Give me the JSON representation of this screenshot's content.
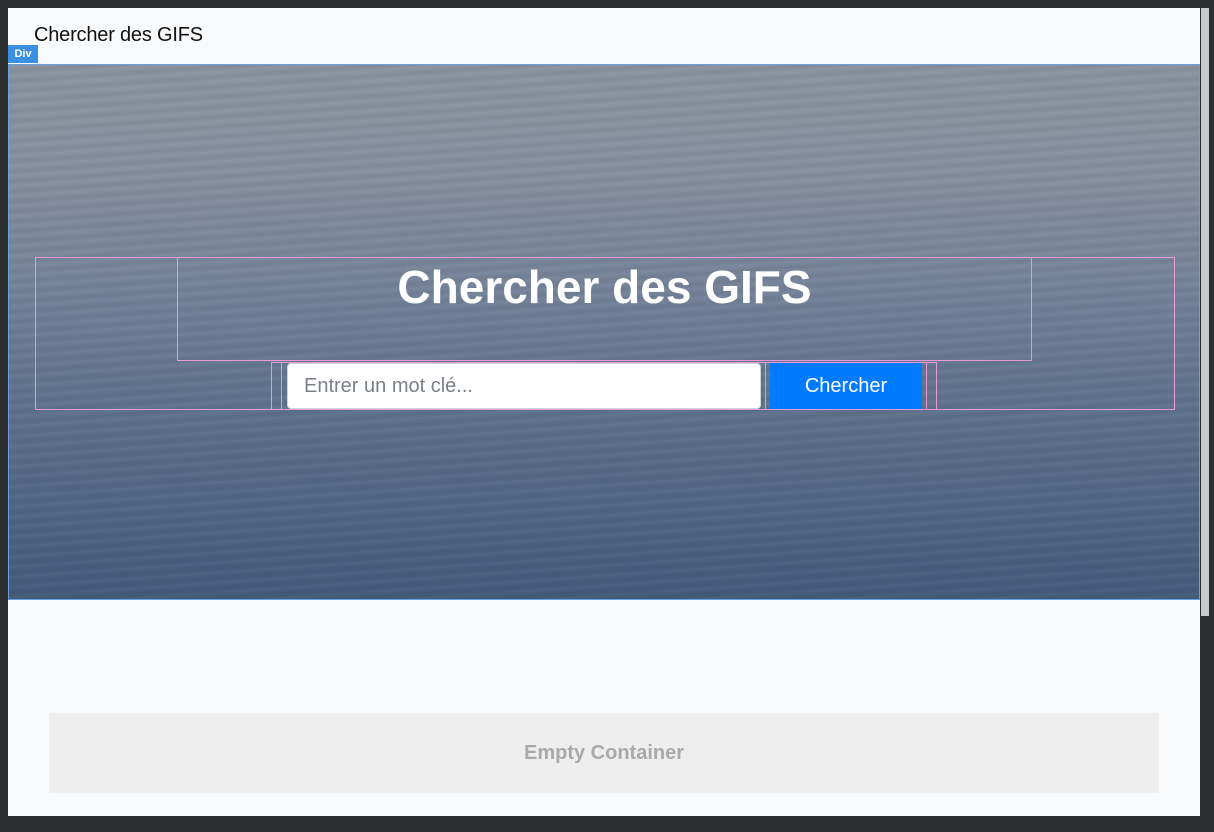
{
  "app": {
    "title": "Chercher des GIFS"
  },
  "overlay": {
    "selected_element_label": "Div"
  },
  "hero": {
    "heading": "Chercher des GIFS",
    "search": {
      "placeholder": "Entrer un mot clé...",
      "value": ""
    },
    "button_label": "Chercher"
  },
  "results": {
    "empty_label": "Empty Container"
  },
  "colors": {
    "button": "#007bff",
    "badge": "#3b8fe0",
    "guide_outline": "#e79ad8",
    "selection_outline": "#6aa0e0"
  }
}
